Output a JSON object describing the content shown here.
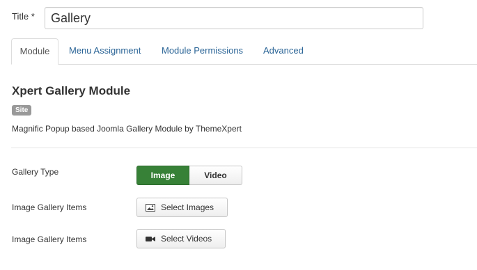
{
  "form": {
    "title_label": "Title *",
    "title_value": "Gallery"
  },
  "tabs": [
    {
      "label": "Module",
      "active": true
    },
    {
      "label": "Menu Assignment",
      "active": false
    },
    {
      "label": "Module Permissions",
      "active": false
    },
    {
      "label": "Advanced",
      "active": false
    }
  ],
  "module": {
    "name": "Xpert Gallery Module",
    "badge": "Site",
    "description": "Magnific Popup based Joomla Gallery Module by ThemeXpert"
  },
  "fields": {
    "gallery_type": {
      "label": "Gallery Type",
      "options": [
        "Image",
        "Video"
      ],
      "selected": "Image"
    },
    "image_items": {
      "label": "Image Gallery Items",
      "button_label": "Select Images",
      "icon": "image-icon"
    },
    "video_items": {
      "label": "Image Gallery Items",
      "button_label": "Select Videos",
      "icon": "video-camera-icon"
    }
  },
  "colors": {
    "active_toggle": "#378137",
    "link": "#2a6496",
    "badge": "#999999"
  }
}
